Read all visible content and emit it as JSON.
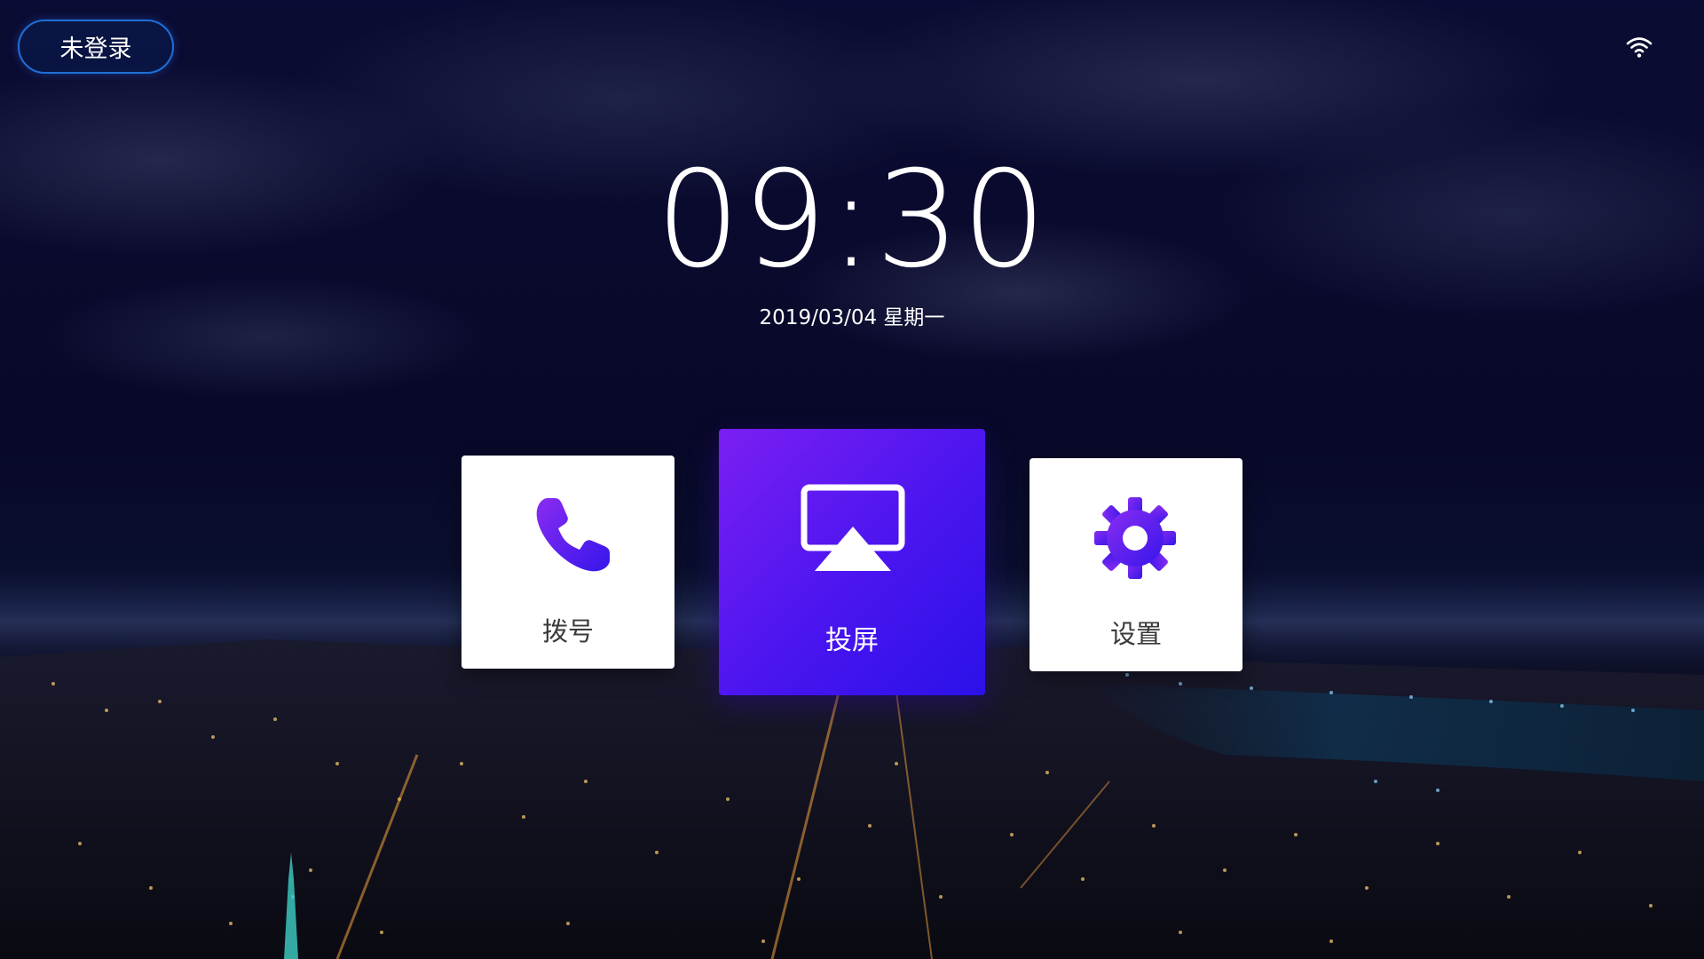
{
  "status_bar": {
    "login_label": "未登录",
    "wifi_icon": "wifi-icon"
  },
  "clock": {
    "time": "09:30",
    "date": "2019/03/04 星期一"
  },
  "tiles": {
    "dial": {
      "label": "拨号",
      "icon": "phone-icon"
    },
    "cast": {
      "label": "投屏",
      "icon": "screen-cast-icon"
    },
    "settings": {
      "label": "设置",
      "icon": "gear-icon"
    }
  },
  "colors": {
    "accent_start": "#7b1ff2",
    "accent_end": "#2b11e8",
    "login_border": "#1f6fd8"
  }
}
